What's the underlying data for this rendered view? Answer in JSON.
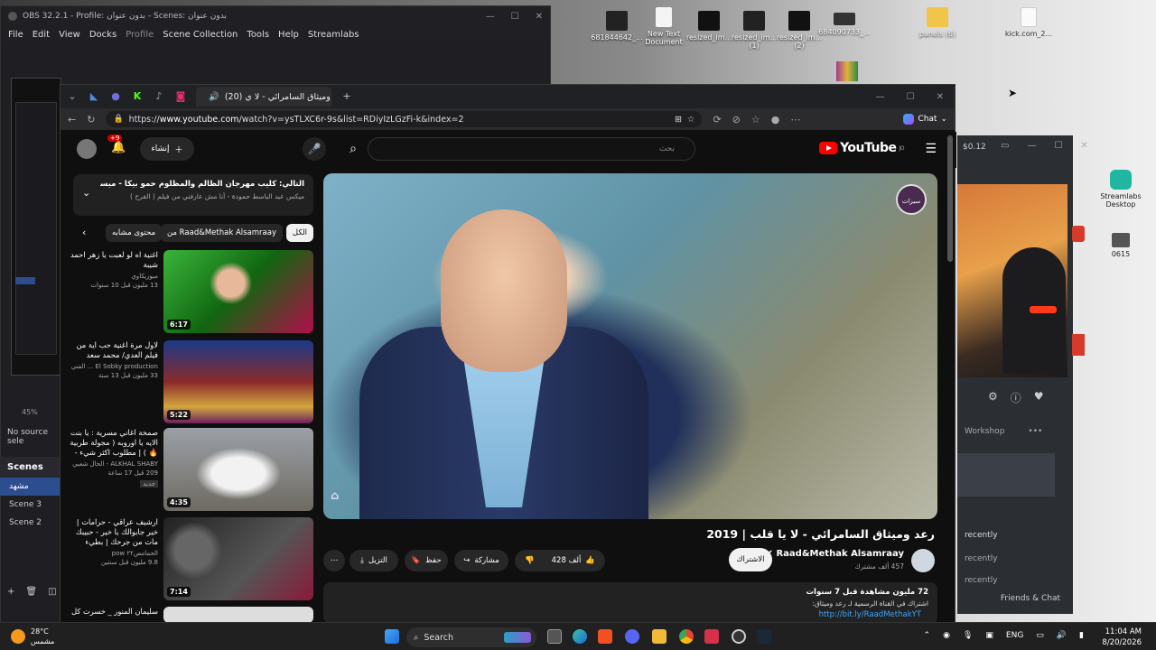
{
  "desktop": {
    "icons": [
      {
        "label": "681844642_..."
      },
      {
        "label": "New Text Document"
      },
      {
        "label": "resized_im..."
      },
      {
        "label": "resized_im... (1)"
      },
      {
        "label": "resized_im... (2)"
      },
      {
        "label": "684090733_..."
      },
      {
        "label": "panels (6)"
      },
      {
        "label": "kick.com_2..."
      },
      {
        "label": "Streamlabs Desktop"
      },
      {
        "label": "0615"
      }
    ]
  },
  "obs": {
    "title": "OBS 32.2.1 - Profile: بدون عنوان - Scenes: بدون عنوان",
    "menu": [
      "File",
      "Edit",
      "View",
      "Docks",
      "Profile",
      "Scene Collection",
      "Tools",
      "Help",
      "Streamlabs"
    ],
    "zoom": "45%",
    "no_source": "No source sele",
    "scenes_header": "Scenes",
    "scenes": [
      "مشهد",
      "Scene 3",
      "Scene 2"
    ]
  },
  "browser": {
    "tab_title": "(20) رعد وميثاق السامرائي - لا ي",
    "url_prefix": "https://",
    "url_host": "www.youtube.com",
    "url_path": "/watch?v=ysTLXC6r-9s&list=RDiyIzLGzFi-k&index=2",
    "copilot_label": "Chat"
  },
  "youtube": {
    "logo_text": "YouTube",
    "logo_region": "JO",
    "search_placeholder": "بحث",
    "create_label": "إنشاء",
    "notif_count": "+9",
    "playlist": {
      "title": "التالي: كليب مهرجان الظالم والمظلوم حمو بيكا - ميسو ميسرة BEKA ...",
      "subtitle": "ميكس عبد الباسط حمودة - أنا مش عارفني من فيلم ( الفرح )"
    },
    "chips": [
      {
        "label": "الكل"
      },
      {
        "label": "من Raad&Methak Alsamraay"
      },
      {
        "label": "محتوى مشابه"
      }
    ],
    "related": [
      {
        "title": "اغنية اه لو لعبت يا زهر احمد شيبة",
        "channel": "ميوزيكاوي",
        "meta": "13 مليون  قبل 10 سنوات",
        "duration": "6:17"
      },
      {
        "title": "لاول مرة اغنية حب اية من فيلم العدي/ محمد سعد",
        "channel": "El Sobky production ... الفني",
        "meta": "33 مليون  قبل 13 سنة",
        "duration": "5:22"
      },
      {
        "title": "صمخة اغاني مسرية : يا بنت الايه يا اوروبه ( مجولة طربية 🔥 ) | مطلوب اكثر شيء - ...",
        "channel": "ALKHAL SHABY - الخال شعبي",
        "meta": "209  قبل 17 ساعة",
        "duration": "4:35",
        "badge": "جديد"
      },
      {
        "title": "ارشيف عراقي - حرامات | خير جابوالك يا خير - حبيبك مات من جرحك | بطيء",
        "channel": "الحمامص٢٢ pow",
        "meta": "9.8 مليون  قبل سنتين",
        "duration": "7:14"
      },
      {
        "title": "سليمان المنور _ خسرت كل",
        "channel": "",
        "meta": "",
        "duration": ""
      }
    ],
    "video": {
      "title": "رعد وميثاق السامرائي - لا يا قلب | 2019",
      "channel": "Raad&Methak Alsamraay",
      "subs": "457 ألف مشترك",
      "subscribe": "الاشتراك",
      "likes": "428 ألف",
      "share": "مشاركة",
      "save": "حفظ",
      "download": "التزيل",
      "views": "72 مليون مشاهدة  قبل 7 سنوات",
      "desc_line": "اشتراك في القناة الرسمية لـ رعد وميثاق:",
      "desc_link": "http://bit.ly/RaadMethakYT",
      "logo_text": "سيزات"
    }
  },
  "streamlabs": {
    "workshop": "Workshop",
    "recently1": "recently",
    "recently2": "recently",
    "recently3": "recently",
    "friends": "Friends & Chat",
    "clock": "$0.12"
  },
  "taskbar": {
    "temp": "28°C",
    "weather": "مشمس",
    "search": "Search",
    "lang": "ENG",
    "time": "11:04 AM",
    "date": "8/20/2026"
  },
  "colors": {
    "youtube_red": "#ff0000",
    "obs_active": "#2c4e8f",
    "link": "#3ea6ff"
  }
}
